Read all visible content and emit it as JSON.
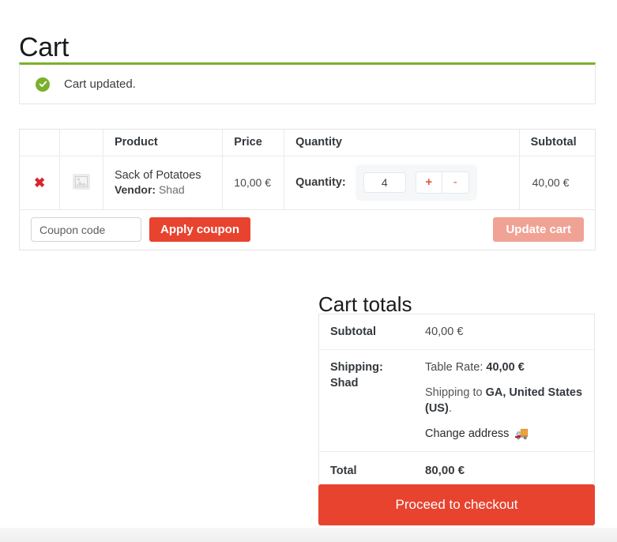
{
  "page": {
    "title": "Cart"
  },
  "notice": {
    "icon": "check-circle-icon",
    "message": "Cart updated.",
    "accent_color": "#7ab02c"
  },
  "cart_table": {
    "headers": [
      "",
      "",
      "Product",
      "Price",
      "Quantity",
      "Subtotal"
    ],
    "rows": [
      {
        "remove_label": "✖",
        "thumbnail": "broken-image-placeholder",
        "product_name": "Sack of Potatoes",
        "vendor_label": "Vendor:",
        "vendor_name": "Shad",
        "price": "10,00 €",
        "quantity_label": "Quantity:",
        "quantity_value": "4",
        "increase_label": "+",
        "decrease_label": "-",
        "subtotal": "40,00 €"
      }
    ],
    "coupon": {
      "placeholder": "Coupon code",
      "value": "",
      "apply_label": "Apply coupon",
      "update_label": "Update cart",
      "apply_color": "#e8432f",
      "update_color": "#f0a294"
    }
  },
  "cart_totals": {
    "title": "Cart totals",
    "subtotal_label": "Subtotal",
    "subtotal_value": "40,00 €",
    "shipping_label": "Shipping:",
    "shipping_vendor": "Shad",
    "shipping_method_prefix": "Table Rate: ",
    "shipping_method_amount": "40,00 €",
    "shipping_to_prefix": "Shipping to ",
    "shipping_to_location": "GA, United States (US)",
    "shipping_to_suffix": ".",
    "change_address_label": "Change address",
    "truck_icon": "🚚",
    "total_label": "Total",
    "total_value": "80,00 €"
  },
  "checkout": {
    "label": "Proceed to checkout",
    "color": "#e8432f"
  }
}
